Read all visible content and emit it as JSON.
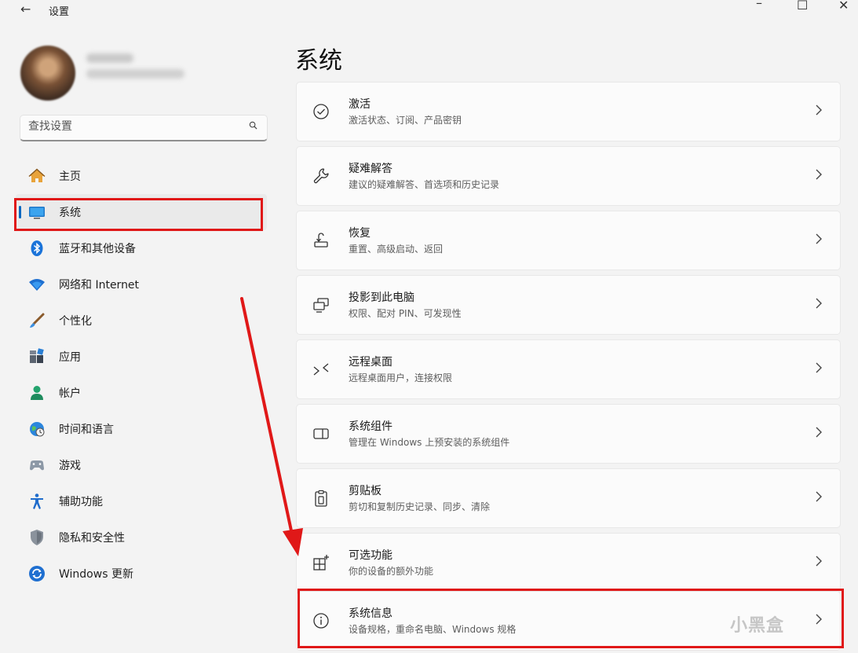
{
  "window": {
    "title": "设置",
    "back": "←",
    "min": "–",
    "max": "☐",
    "close": "✕"
  },
  "search": {
    "placeholder": "查找设置"
  },
  "sidebar": {
    "items": [
      {
        "label": "主页"
      },
      {
        "label": "系统"
      },
      {
        "label": "蓝牙和其他设备"
      },
      {
        "label": "网络和 Internet"
      },
      {
        "label": "个性化"
      },
      {
        "label": "应用"
      },
      {
        "label": "帐户"
      },
      {
        "label": "时间和语言"
      },
      {
        "label": "游戏"
      },
      {
        "label": "辅助功能"
      },
      {
        "label": "隐私和安全性"
      },
      {
        "label": "Windows 更新"
      }
    ]
  },
  "main": {
    "title": "系统",
    "cards": [
      {
        "title": "激活",
        "subtitle": "激活状态、订阅、产品密钥"
      },
      {
        "title": "疑难解答",
        "subtitle": "建议的疑难解答、首选项和历史记录"
      },
      {
        "title": "恢复",
        "subtitle": "重置、高级启动、返回"
      },
      {
        "title": "投影到此电脑",
        "subtitle": "权限、配对 PIN、可发现性"
      },
      {
        "title": "远程桌面",
        "subtitle": "远程桌面用户，连接权限"
      },
      {
        "title": "系统组件",
        "subtitle": "管理在 Windows 上预安装的系统组件"
      },
      {
        "title": "剪贴板",
        "subtitle": "剪切和复制历史记录、同步、清除"
      },
      {
        "title": "可选功能",
        "subtitle": "你的设备的额外功能"
      },
      {
        "title": "系统信息",
        "subtitle": "设备规格，重命名电脑、Windows 规格"
      }
    ]
  },
  "watermark": "小黑盒",
  "colors": {
    "accent": "#0067c0",
    "highlight": "#e01818"
  }
}
